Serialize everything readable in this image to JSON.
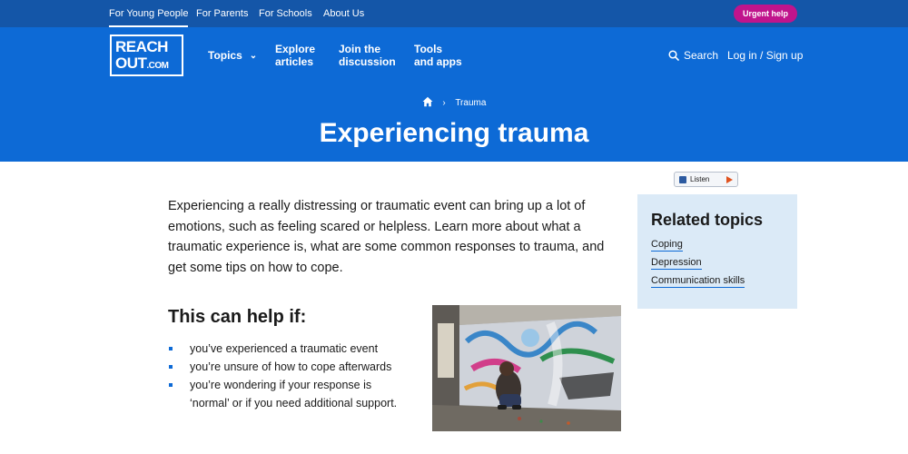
{
  "topbar": {
    "audiences": [
      "For Young People",
      "For Parents",
      "For Schools",
      "About Us"
    ],
    "urgent_label": "Urgent help"
  },
  "logo": {
    "line1": "REACH",
    "line2": "OUT",
    "line2_suffix": ".COM"
  },
  "nav": {
    "topics": "Topics",
    "explore_1": "Explore",
    "explore_2": "articles",
    "join_1": "Join the",
    "join_2": "discussion",
    "tools_1": "Tools",
    "tools_2": "and apps",
    "search_label": "Search",
    "login_label": "Log in / Sign up"
  },
  "hero": {
    "breadcrumb_current": "Trauma",
    "title": "Experiencing trauma"
  },
  "listen": {
    "label": "Listen"
  },
  "intro": "Experiencing a really distressing or traumatic event can bring up a lot of emotions, such as feeling scared or helpless. Learn more about what a traumatic experience is, what are some common responses to trauma, and get some tips on how to cope.",
  "help": {
    "title": "This can help if:",
    "items": [
      "you’ve experienced a traumatic event",
      "you’re unsure of how to cope afterwards",
      "you’re wondering if your response is ‘normal’ or if you need additional support."
    ]
  },
  "related": {
    "title": "Related topics",
    "links": [
      "Coping",
      "Depression",
      "Communication skills"
    ]
  },
  "colors": {
    "topbar": "#1456a8",
    "brand_blue": "#0d6ad6",
    "urgent_pink": "#c0148c",
    "related_bg": "#dbeaf7"
  },
  "icons": [
    "search-icon",
    "home-icon",
    "chevron-down-icon",
    "chevron-right-icon",
    "speaker-icon",
    "play-icon"
  ]
}
